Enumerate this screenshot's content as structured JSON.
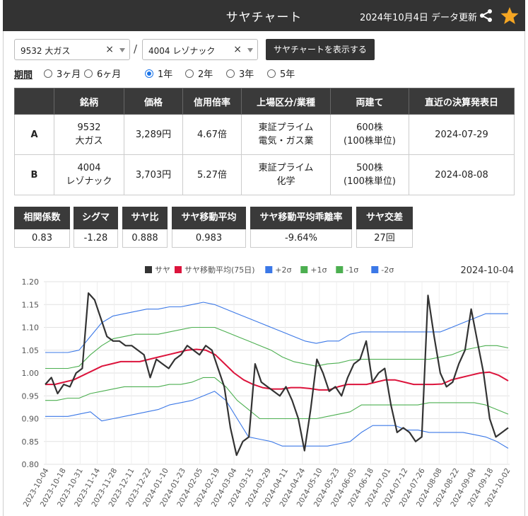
{
  "header": {
    "title": "サヤチャート",
    "updated": "2024年10月4日 データ更新"
  },
  "selectors": {
    "a": "9532 大ガス",
    "b": "4004 レゾナック",
    "clear": "×",
    "separator": "/",
    "show_button": "サヤチャートを表示する"
  },
  "period": {
    "label": "期間",
    "options": [
      "3ヶ月",
      "6ヶ月",
      "1年",
      "2年",
      "3年",
      "5年"
    ],
    "selected": "1年"
  },
  "table": {
    "headers": [
      "",
      "銘柄",
      "価格",
      "信用倍率",
      "上場区分/業種",
      "両建て",
      "直近の決算発表日"
    ],
    "rows": [
      {
        "label": "A",
        "code": "9532",
        "name": "大ガス",
        "price": "3,289円",
        "margin": "4.67倍",
        "market": "東証プライム",
        "sector": "電気・ガス業",
        "lot": "600株",
        "unit": "(100株単位)",
        "date": "2024-07-29"
      },
      {
        "label": "B",
        "code": "4004",
        "name": "レゾナック",
        "price": "3,703円",
        "margin": "5.27倍",
        "market": "東証プライム",
        "sector": "化学",
        "lot": "500株",
        "unit": "(100株単位)",
        "date": "2024-08-08"
      }
    ]
  },
  "stats": [
    {
      "label": "相関係数",
      "value": "0.83"
    },
    {
      "label": "シグマ",
      "value": "-1.28"
    },
    {
      "label": "サヤ比",
      "value": "0.888"
    },
    {
      "label": "サヤ移動平均",
      "value": "0.983"
    },
    {
      "label": "サヤ移動平均乖離率",
      "value": "-9.64%"
    },
    {
      "label": "サヤ交差",
      "value": "27回"
    }
  ],
  "colors": {
    "dark": "#333333",
    "saya": "#333333",
    "ma": "#dc143c",
    "p2": "#3b78e7",
    "p1": "#4caf50",
    "m1": "#4caf50",
    "m2": "#3b78e7",
    "star": "#f5a623"
  },
  "chart_data": {
    "type": "line",
    "date_label": "2024-10-04",
    "ylim": [
      0.8,
      1.2
    ],
    "yticks": [
      "1.20",
      "1.15",
      "1.10",
      "1.05",
      "1.00",
      "0.95",
      "0.90",
      "0.85",
      "0.80"
    ],
    "xticks": [
      "2023-10-04",
      "2023-10-18",
      "2023-10-31",
      "2023-11-14",
      "2023-11-28",
      "2023-12-11",
      "2023-12-22",
      "2024-01-10",
      "2024-01-23",
      "2024-02-05",
      "2024-02-19",
      "2024-03-04",
      "2024-03-15",
      "2024-03-29",
      "2024-04-11",
      "2024-04-24",
      "2024-05-10",
      "2024-05-23",
      "2024-06-05",
      "2024-06-18",
      "2024-07-01",
      "2024-07-12",
      "2024-07-26",
      "2024-08-08",
      "2024-08-22",
      "2024-09-04",
      "2024-09-18",
      "2024-10-02"
    ],
    "series": [
      {
        "name": "サヤ",
        "color": "#333333",
        "values": [
          0.975,
          0.99,
          0.955,
          0.975,
          0.97,
          1.0,
          1.01,
          1.175,
          1.16,
          1.12,
          1.08,
          1.07,
          1.07,
          1.06,
          1.06,
          1.05,
          1.04,
          0.99,
          1.03,
          1.02,
          1.01,
          1.03,
          1.04,
          1.06,
          1.05,
          1.04,
          1.06,
          1.05,
          1.01,
          0.97,
          0.88,
          0.82,
          0.85,
          0.86,
          1.02,
          0.98,
          0.97,
          0.96,
          0.95,
          0.97,
          0.94,
          0.9,
          0.83,
          0.92,
          1.03,
          1.0,
          0.96,
          0.97,
          0.95,
          0.99,
          1.02,
          1.03,
          1.07,
          0.98,
          1.0,
          1.01,
          0.93,
          0.87,
          0.88,
          0.87,
          0.85,
          0.86,
          1.17,
          1.08,
          1.0,
          0.97,
          0.98,
          1.02,
          1.05,
          1.14,
          1.07,
          1.0,
          0.9,
          0.86,
          0.87,
          0.88
        ]
      },
      {
        "name": "サヤ移動平均(75日)",
        "color": "#dc143c",
        "values": [
          0.975,
          0.975,
          0.98,
          0.985,
          0.995,
          1.005,
          1.015,
          1.02,
          1.025,
          1.025,
          1.025,
          1.03,
          1.035,
          1.04,
          1.045,
          1.05,
          1.052,
          1.05,
          1.04,
          1.02,
          1.0,
          0.985,
          0.975,
          0.968,
          0.965,
          0.965,
          0.968,
          0.968,
          0.966,
          0.963,
          0.963,
          0.97,
          0.975,
          0.975,
          0.975,
          0.98,
          0.985,
          0.985,
          0.98,
          0.975,
          0.975,
          0.975,
          0.976,
          0.985,
          0.99,
          0.995,
          1.0,
          1.002,
          0.995,
          0.983
        ]
      },
      {
        "name": "+2σ",
        "color": "#3b78e7",
        "values": [
          1.045,
          1.045,
          1.045,
          1.05,
          1.08,
          1.11,
          1.125,
          1.13,
          1.135,
          1.14,
          1.14,
          1.145,
          1.145,
          1.15,
          1.155,
          1.15,
          1.14,
          1.13,
          1.12,
          1.11,
          1.1,
          1.09,
          1.08,
          1.07,
          1.065,
          1.07,
          1.07,
          1.085,
          1.09,
          1.09,
          1.09,
          1.09,
          1.09,
          1.09,
          1.09,
          1.09,
          1.1,
          1.11,
          1.12,
          1.13,
          1.13,
          1.13
        ]
      },
      {
        "name": "+1σ",
        "color": "#4caf50",
        "values": [
          1.01,
          1.01,
          1.01,
          1.015,
          1.04,
          1.06,
          1.075,
          1.08,
          1.085,
          1.085,
          1.085,
          1.09,
          1.095,
          1.1,
          1.1,
          1.1,
          1.09,
          1.08,
          1.07,
          1.06,
          1.05,
          1.035,
          1.025,
          1.02,
          1.015,
          1.02,
          1.022,
          1.028,
          1.03,
          1.03,
          1.03,
          1.03,
          1.03,
          1.03,
          1.03,
          1.035,
          1.04,
          1.05,
          1.055,
          1.06,
          1.06,
          1.055
        ]
      },
      {
        "name": "-1σ",
        "color": "#4caf50",
        "values": [
          0.94,
          0.94,
          0.945,
          0.945,
          0.955,
          0.96,
          0.965,
          0.97,
          0.97,
          0.97,
          0.97,
          0.975,
          0.975,
          0.98,
          0.99,
          0.99,
          0.97,
          0.94,
          0.92,
          0.9,
          0.9,
          0.9,
          0.9,
          0.9,
          0.9,
          0.905,
          0.91,
          0.915,
          0.93,
          0.93,
          0.93,
          0.93,
          0.93,
          0.93,
          0.935,
          0.935,
          0.935,
          0.935,
          0.935,
          0.93,
          0.92,
          0.91
        ]
      },
      {
        "name": "-2σ",
        "color": "#3b78e7",
        "values": [
          0.905,
          0.905,
          0.905,
          0.91,
          0.915,
          0.895,
          0.9,
          0.905,
          0.91,
          0.915,
          0.92,
          0.93,
          0.935,
          0.94,
          0.95,
          0.96,
          0.94,
          0.9,
          0.86,
          0.855,
          0.85,
          0.84,
          0.84,
          0.84,
          0.84,
          0.84,
          0.845,
          0.85,
          0.87,
          0.885,
          0.885,
          0.885,
          0.875,
          0.875,
          0.87,
          0.87,
          0.87,
          0.87,
          0.865,
          0.86,
          0.85,
          0.835
        ]
      }
    ]
  }
}
